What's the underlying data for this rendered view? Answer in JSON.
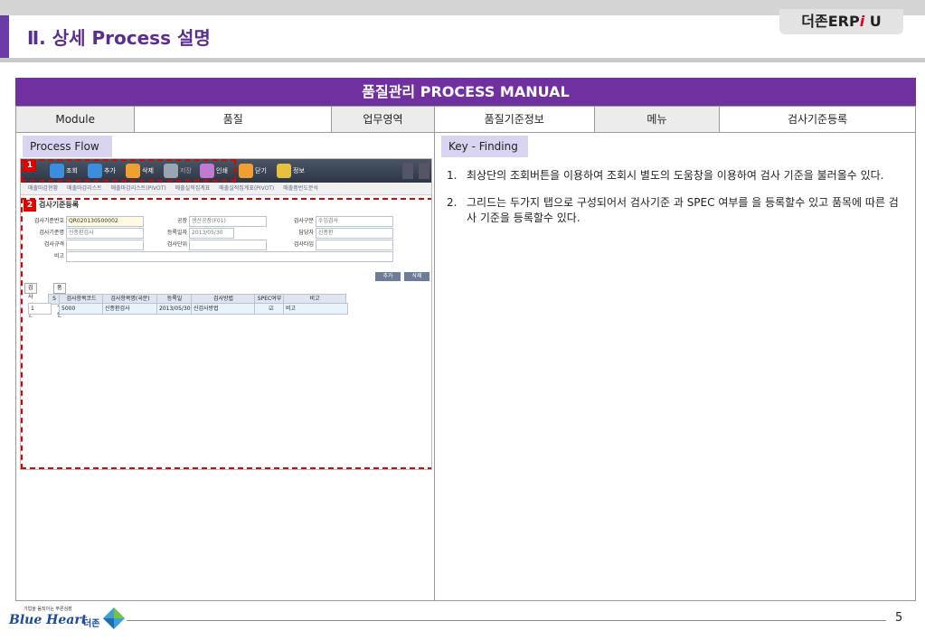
{
  "brand": {
    "prefix": "더존ERP",
    "slash": "i",
    "suffix": " U"
  },
  "section_title": "Ⅱ. 상세 Process 설명",
  "manual_title": "품질관리 PROCESS MANUAL",
  "meta": {
    "module_label": "Module",
    "module_value": "품질",
    "area_label": "업무영역",
    "area_value": "품질기준정보",
    "menu_label": "메뉴",
    "menu_value": "검사기준등록"
  },
  "process_flow_label": "Process Flow",
  "key_finding_label": "Key - Finding",
  "findings": [
    {
      "num": "1.",
      "text": "최상단의 조회버튼을 이용하여 조회시 별도의 도움창을 이용하여 검사 기준을 불러올수 있다."
    },
    {
      "num": "2.",
      "text": "그리드는 두가지 탭으로 구성되어서 검사기준 과 SPEC 여부를 을 등록할수 있고 품목에 따른 검사 기준을 등록할수 있다."
    }
  ],
  "screenshot": {
    "badges": [
      "1",
      "2"
    ],
    "toolbar": [
      {
        "label": "조회",
        "icon": "search-icon",
        "color": "#3b8de0"
      },
      {
        "label": "추가",
        "icon": "plus-icon",
        "color": "#3b8de0"
      },
      {
        "label": "삭제",
        "icon": "trash-icon",
        "color": "#f0a030"
      },
      {
        "label": "저장",
        "icon": "save-icon",
        "color": "#9aa4b3"
      },
      {
        "label": "인쇄",
        "icon": "print-icon",
        "color": "#c07ad0"
      },
      {
        "label": "닫기",
        "icon": "close-icon",
        "color": "#f0a030"
      },
      {
        "label": "정보",
        "icon": "info-icon",
        "color": "#e8c040"
      }
    ],
    "subtabs": [
      "매출마감현황",
      "매출마감리스트",
      "매출마감리스트(PIVOT)",
      "매출실적집계표",
      "매출실적집계표(PIVOT)",
      "매출품번도분석"
    ],
    "form_title": "검사기준등록",
    "form": {
      "code_label": "검사기준번호",
      "code_value": "QR020130500002",
      "plant_label": "공장",
      "plant_value": "생산공장(F01)",
      "type_label": "검사구분",
      "type_value": "수입검사",
      "name_label": "검사기준명",
      "name_value": "신종환검사",
      "date_label": "등록일자",
      "date_value": "2013/05/30",
      "owner_label": "담당자",
      "owner_value": "신종환",
      "spec_label": "검사규격",
      "unit_label": "검사단위",
      "kind_label": "검사타입",
      "note_label": "비고"
    },
    "buttons": {
      "add": "추가",
      "delete": "삭제"
    },
    "grid_tabs": [
      "검사기준",
      "품목기준"
    ],
    "grid_headers": [
      "S",
      "검사항목코드",
      "검사항목명(국문)",
      "등록일",
      "검사방법",
      "SPEC여부",
      "비고"
    ],
    "grid_row": {
      "idx": "1",
      "code": "5000",
      "name": "신종환검사",
      "date": "2013/05/30",
      "method": "신검사방법",
      "spec": "☑",
      "note": "비고"
    }
  },
  "footer": {
    "tagline": "기업을 움직이는 푸른심장",
    "logo_text": "Blue Heart",
    "logo_kr": "더존",
    "page": "5"
  }
}
